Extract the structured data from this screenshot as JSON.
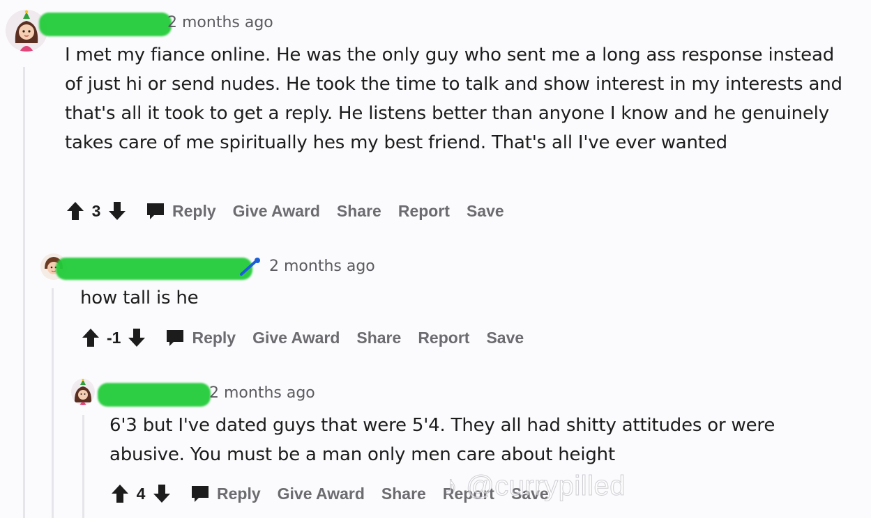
{
  "comments": [
    {
      "time": "2 months ago",
      "text": "I met my fiance online. He was the only guy who sent me a long ass response instead of just hi or send nudes. He took the time to talk and show interest in my interests and that's all it took to get a reply. He listens better than anyone I know and he genuinely takes care of me spiritually hes my best friend. That's all I've ever wanted",
      "score": "3",
      "actions": {
        "reply": "Reply",
        "award": "Give Award",
        "share": "Share",
        "report": "Report",
        "save": "Save"
      }
    },
    {
      "time": "2 months ago",
      "text": "how tall is he",
      "score": "-1",
      "actions": {
        "reply": "Reply",
        "award": "Give Award",
        "share": "Share",
        "report": "Report",
        "save": "Save"
      }
    },
    {
      "time": "2 months ago",
      "text": "6'3 but I've dated guys that were 5'4. They all had shitty attitudes or were abusive. You must be a man only men care about height",
      "score": "4",
      "actions": {
        "reply": "Reply",
        "award": "Give Award",
        "share": "Share",
        "report": "Report",
        "save": "Save"
      }
    }
  ],
  "watermark": "@currypilled",
  "icons": [
    "upvote-icon",
    "downvote-icon",
    "comment-bubble-icon",
    "edit-pencil-icon",
    "tiktok-logo-icon"
  ],
  "colors": {
    "redaction": "#22cc3a",
    "action_text": "#6b6b70",
    "thread_line": "#e6e6ea"
  }
}
